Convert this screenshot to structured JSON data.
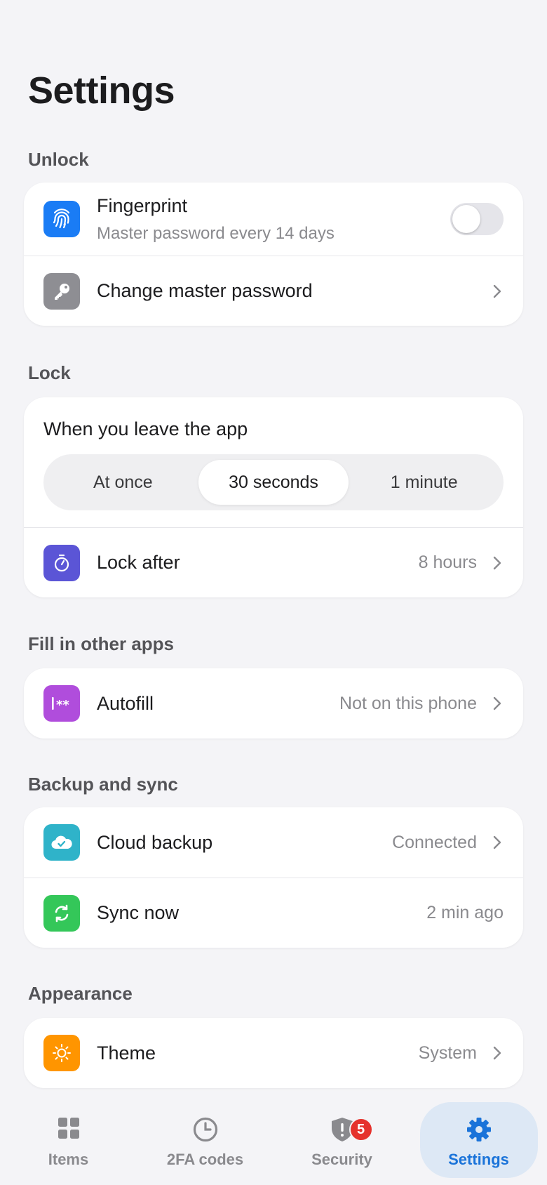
{
  "page": {
    "title": "Settings"
  },
  "sections": {
    "unlock": {
      "label": "Unlock",
      "fingerprint": {
        "title": "Fingerprint",
        "subtitle": "Master password every 14 days",
        "enabled": false,
        "icon": "fingerprint-icon",
        "color": "#1a7cf5"
      },
      "change_password": {
        "title": "Change master password",
        "icon": "key-icon",
        "color": "#8e8e93"
      }
    },
    "lock": {
      "label": "Lock",
      "leave_title": "When you leave the app",
      "options": [
        "At once",
        "30 seconds",
        "1 minute"
      ],
      "selected": "30 seconds",
      "lock_after": {
        "title": "Lock after",
        "value": "8 hours",
        "icon": "timer-icon",
        "color": "#5b55d6"
      }
    },
    "fill": {
      "label": "Fill in other apps",
      "autofill": {
        "title": "Autofill",
        "value": "Not on this phone",
        "icon": "autofill-icon",
        "color": "#b04ddc"
      }
    },
    "backup": {
      "label": "Backup and sync",
      "cloud": {
        "title": "Cloud backup",
        "value": "Connected",
        "icon": "cloud-check-icon",
        "color": "#2fb3c9"
      },
      "sync": {
        "title": "Sync now",
        "value": "2 min ago",
        "icon": "sync-icon",
        "color": "#34c759"
      }
    },
    "appearance": {
      "label": "Appearance",
      "theme": {
        "title": "Theme",
        "value": "System",
        "icon": "sun-icon",
        "color": "#ff9500"
      }
    }
  },
  "tabbar": {
    "items": [
      {
        "label": "Items",
        "icon": "grid-icon"
      },
      {
        "label": "2FA codes",
        "icon": "clock-icon"
      },
      {
        "label": "Security",
        "icon": "shield-alert-icon",
        "badge": "5"
      },
      {
        "label": "Settings",
        "icon": "gear-icon",
        "active": true
      }
    ],
    "accent": "#1a73d9",
    "badge_color": "#e5322d"
  }
}
